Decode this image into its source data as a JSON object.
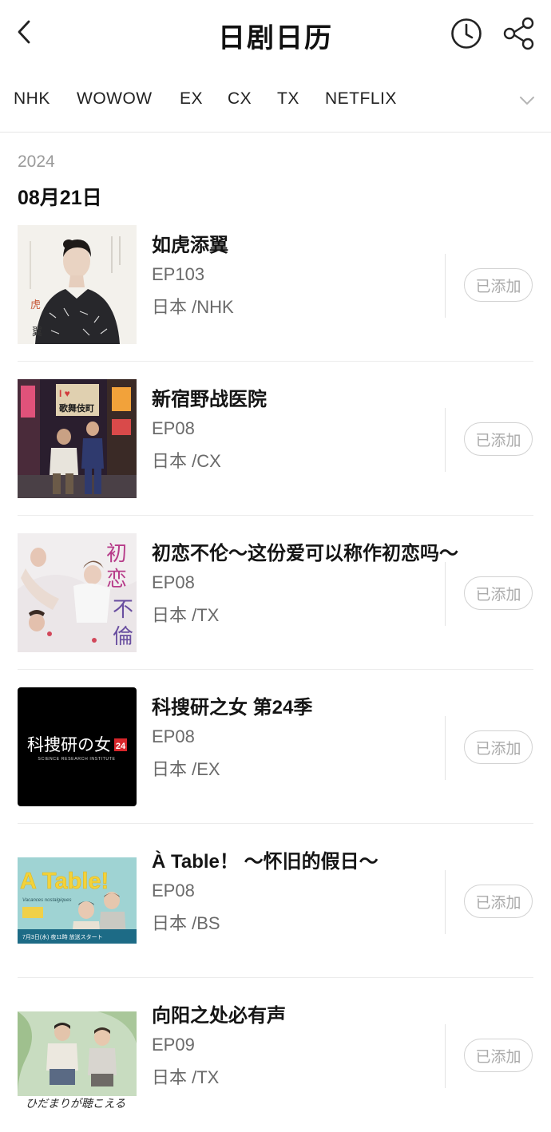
{
  "header": {
    "title": "日剧日历",
    "back_icon": "chevron-left-icon",
    "history_icon": "clock-icon",
    "share_icon": "share-icon"
  },
  "tabs": {
    "items": [
      "NHK",
      "WOWOW",
      "EX",
      "CX",
      "TX",
      "NETFLIX"
    ],
    "expand_icon": "chevron-down-icon"
  },
  "date_section": {
    "year": "2024",
    "date": "08月21日"
  },
  "shows": [
    {
      "title": "如虎添翼",
      "episode": "EP103",
      "channel": "日本 /NHK",
      "button": "已添加",
      "poster_text": [
        "虎",
        "翼"
      ]
    },
    {
      "title": "新宿野战医院",
      "episode": "EP08",
      "channel": "日本 /CX",
      "button": "已添加",
      "poster_text": [
        "I ♥",
        "歌舞伎町"
      ]
    },
    {
      "title": "初恋不伦～这份爱可以称作初恋吗～",
      "episode": "EP08",
      "channel": "日本 /TX",
      "button": "已添加",
      "poster_text": [
        "初",
        "恋",
        "不",
        "倫"
      ]
    },
    {
      "title": "科搜研之女 第24季",
      "episode": "EP08",
      "channel": "日本 /EX",
      "button": "已添加",
      "poster_text": [
        "科捜研の女",
        "24",
        "SCIENCE RESEARCH INSTITUTE"
      ]
    },
    {
      "title": "À Table！ ～怀旧的假日～",
      "episode": "EP08",
      "channel": "日本 /BS",
      "button": "已添加",
      "poster_text": [
        "A Table!",
        "Vacances nostalgiques",
        "7月3日(水) 夜11時 放送スタート"
      ]
    },
    {
      "title": "向阳之处必有声",
      "episode": "EP09",
      "channel": "日本 /TX",
      "button": "已添加",
      "poster_text": [
        "ひだまりが聴こえる"
      ]
    }
  ],
  "colors": {
    "text_primary": "#151515",
    "text_secondary": "#6a6a6a",
    "year_gray": "#9a9a9a",
    "button_border": "#d2d2d2",
    "button_text": "#aaaaaa"
  }
}
